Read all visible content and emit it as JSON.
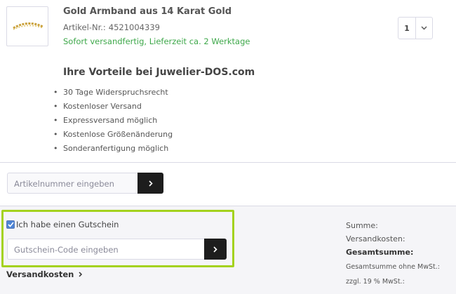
{
  "product": {
    "title": "Gold Armband aus 14 Karat Gold",
    "sku_label": "Artikel-Nr.:",
    "sku": "4521004339",
    "shipping": "Sofort versandfertig, Lieferzeit ca. 2 Werktage",
    "quantity": "1",
    "image_icon": "gold-bracelet-image"
  },
  "benefits": {
    "title": "Ihre Vorteile bei Juwelier-DOS.com",
    "items": [
      "30 Tage Widerspruchsrecht",
      "Kostenloser Versand",
      "Expressversand möglich",
      "Kostenlose Größenänderung",
      "Sonderanfertigung möglich"
    ]
  },
  "article_entry": {
    "placeholder": "Artikelnummer eingeben",
    "button_icon": "chevron-right-icon"
  },
  "voucher": {
    "checkbox_label": "Ich habe einen Gutschein",
    "checked": true,
    "placeholder": "Gutschein-Code eingeben",
    "button_icon": "chevron-right-icon"
  },
  "shipping_link": {
    "label": "Versandkosten",
    "icon": "chevron-right-icon"
  },
  "summary": {
    "sum": "Summe:",
    "shipping_cost": "Versandkosten:",
    "total": "Gesamtsumme:",
    "total_net": "Gesamtsumme ohne MwSt.:",
    "vat": "zzgl. 19 % MwSt.:"
  },
  "colors": {
    "shipping_green": "#3ea84a",
    "highlight_border": "#a4d21e",
    "button_dark": "#1d1d1d"
  }
}
